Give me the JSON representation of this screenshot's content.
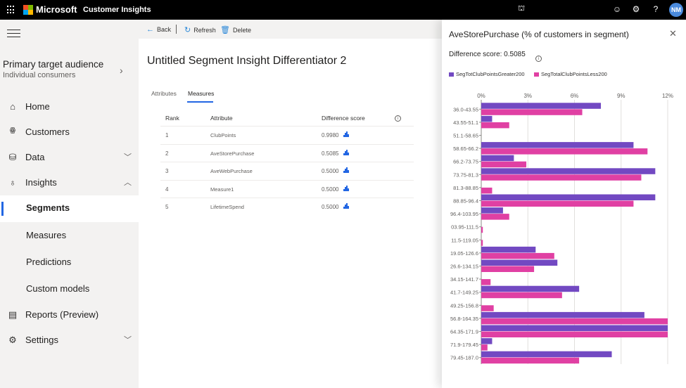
{
  "topbar": {
    "brand": "Microsoft",
    "app_name": "Customer Insights",
    "icons": [
      "environment-icon",
      "feedback-smiley-icon",
      "settings-gear-icon",
      "help-icon"
    ],
    "avatar_initials": "NM",
    "avatar_color": "#4a8bde"
  },
  "sidebar": {
    "audience_title": "Primary target audience",
    "audience_subtitle": "Individual consumers",
    "items": [
      {
        "label": "Home",
        "icon": "home-icon"
      },
      {
        "label": "Customers",
        "icon": "customers-icon",
        "chevron": null
      },
      {
        "label": "Data",
        "icon": "data-icon",
        "chevron": "down"
      },
      {
        "label": "Insights",
        "icon": "lightbulb-icon",
        "chevron": "up"
      },
      {
        "label": "Segments",
        "active": true
      },
      {
        "label": "Measures"
      },
      {
        "label": "Predictions"
      },
      {
        "label": "Custom models"
      },
      {
        "label": "Reports (Preview)",
        "icon": "report-icon"
      },
      {
        "label": "Settings",
        "icon": "settings-icon",
        "chevron": "down"
      }
    ]
  },
  "commandbar": {
    "back": "Back",
    "refresh": "Refresh",
    "delete": "Delete"
  },
  "main": {
    "title": "Untitled Segment Insight Differentiator 2",
    "tabs": [
      {
        "label": "Attributes",
        "active": false
      },
      {
        "label": "Measures",
        "active": true
      }
    ],
    "table": {
      "columns": [
        "Rank",
        "Attribute",
        "Difference score"
      ],
      "rows": [
        {
          "rank": "1",
          "attribute": "ClubPoints",
          "score": "0.9980"
        },
        {
          "rank": "2",
          "attribute": "AveStorePurchase",
          "score": "0.5085"
        },
        {
          "rank": "3",
          "attribute": "AveWebPurchase",
          "score": "0.5000"
        },
        {
          "rank": "4",
          "attribute": "Measure1",
          "score": "0.5000"
        },
        {
          "rank": "5",
          "attribute": "LifetimeSpend",
          "score": "0.5000"
        }
      ]
    }
  },
  "panel": {
    "title": "AveStorePurchase (% of customers in segment)",
    "difference_score": "Difference score: 0.5085"
  },
  "chart_data": {
    "type": "bar",
    "orientation": "horizontal",
    "title": "AveStorePurchase (% of customers in segment)",
    "xlabel": "",
    "ylabel": "",
    "xlim": [
      0,
      12
    ],
    "xticks": [
      "0%",
      "3%",
      "6%",
      "9%",
      "12%"
    ],
    "xtick_values": [
      0,
      3,
      6,
      9,
      12
    ],
    "grid": true,
    "legend": "top-left",
    "categories": [
      "36.0-43.55",
      "43.55-51.1",
      "51.1-58.65",
      "58.65-66.2",
      "66.2-73.75",
      "73.75-81.3",
      "81.3-88.85",
      "88.85-96.4",
      "96.4-103.95",
      "03.95-111.5",
      "11.5-119.05",
      "19.05-126.6",
      "26.6-134.15",
      "34.15-141.7",
      "41.7-149.25",
      "49.25-156.8",
      "56.8-164.35",
      "64.35-171.9",
      "71.9-179.45",
      "79.45-187.0"
    ],
    "series": [
      {
        "name": "SegTotClubPointsGreater200",
        "color": "#7249c2",
        "values": [
          7.7,
          0.7,
          0,
          9.8,
          2.1,
          11.2,
          0,
          11.2,
          1.4,
          0,
          0,
          3.5,
          4.9,
          0,
          6.3,
          0,
          10.5,
          12.0,
          0.7,
          8.4
        ]
      },
      {
        "name": "SegTotalClubPointsLess200",
        "color": "#e040a3",
        "values": [
          6.5,
          1.8,
          0,
          10.7,
          2.9,
          10.3,
          0.7,
          9.8,
          1.8,
          0.1,
          0.1,
          4.7,
          3.4,
          0.6,
          5.2,
          0.8,
          12.0,
          12.0,
          0.4,
          6.3
        ]
      }
    ]
  }
}
